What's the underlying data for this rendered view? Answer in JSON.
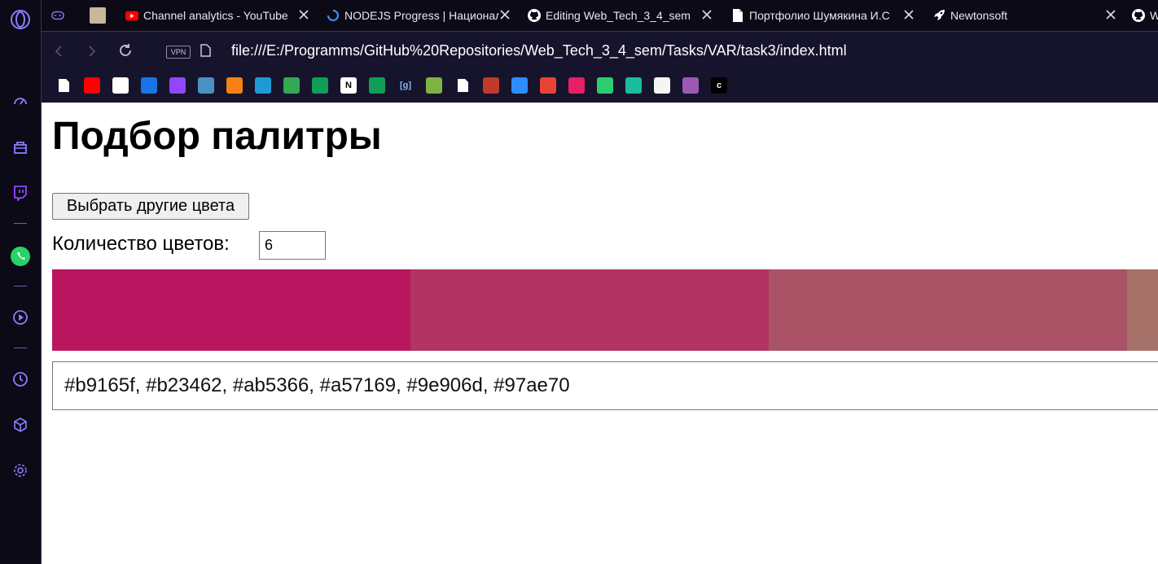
{
  "browser": {
    "tabs": [
      {
        "label": "",
        "icon": "gamepad-icon"
      },
      {
        "label": "",
        "icon": "emblem-icon"
      },
      {
        "label": "Channel analytics - YouTube",
        "icon": "youtube-icon"
      },
      {
        "label": "NODEJS Progress | Национальный",
        "icon": "loading-spinner-icon"
      },
      {
        "label": "Editing Web_Tech_3_4_sem",
        "icon": "github-icon"
      },
      {
        "label": "Портфолио Шумякина И.С",
        "icon": "document-icon"
      },
      {
        "label": "Newtonsoft",
        "icon": "rocket-icon"
      },
      {
        "label": "W",
        "icon": "github-icon"
      }
    ],
    "address": {
      "vpn_label": "VPN",
      "url": "file:///E:/Programms/GitHub%20Repositories/Web_Tech_3_4_sem/Tasks/VAR/task3/index.html"
    },
    "bookmarks": [
      {
        "icon": "page-icon",
        "color": "#ffffff"
      },
      {
        "icon": "youtube-icon",
        "color": "#ff0000"
      },
      {
        "icon": "github-icon",
        "color": "#ffffff"
      },
      {
        "icon": "mail-icon",
        "color": "#1a73e8"
      },
      {
        "icon": "twitch-icon",
        "color": "#9146ff"
      },
      {
        "icon": "m-icon",
        "color": "#4a90c2"
      },
      {
        "icon": "moodle-icon",
        "color": "#f98012"
      },
      {
        "icon": "spinner-icon",
        "color": "#1e9bd7"
      },
      {
        "icon": "google-drive-icon",
        "color": "#34a853"
      },
      {
        "icon": "sheets-plus-icon",
        "color": "#0f9d58"
      },
      {
        "icon": "notion-icon",
        "color": "#ffffff"
      },
      {
        "icon": "sheets-plus-icon",
        "color": "#0f9d58"
      },
      {
        "icon": "bracket-g-icon",
        "color": "#8ab4f8",
        "text": "[g]"
      },
      {
        "icon": "avatar-icon",
        "color": "#7cb342"
      },
      {
        "icon": "page-icon",
        "color": "#ffffff"
      },
      {
        "icon": "bird-icon",
        "color": "#c0392b"
      },
      {
        "icon": "chat-icon",
        "color": "#2d8cff"
      },
      {
        "icon": "gmail-icon",
        "color": "#ea4335"
      },
      {
        "icon": "star-icon",
        "color": "#e91e63"
      },
      {
        "icon": "mountain-icon",
        "color": "#2ecc71"
      },
      {
        "icon": "diamond-icon",
        "color": "#1abc9c"
      },
      {
        "icon": "gear-badge-icon",
        "color": "#f5f5f5"
      },
      {
        "icon": "circle-icon",
        "color": "#9b59b6"
      },
      {
        "icon": "c-icon",
        "color": "#000000"
      }
    ]
  },
  "sidebar": {
    "items": [
      {
        "icon": "opera-logo-icon"
      },
      {
        "icon": "speed-dial-icon"
      },
      {
        "icon": "bag-icon"
      },
      {
        "icon": "twitch-icon"
      },
      {
        "icon": "whatsapp-icon"
      },
      {
        "icon": "player-icon"
      },
      {
        "icon": "history-icon"
      },
      {
        "icon": "box-icon"
      },
      {
        "icon": "settings-icon"
      }
    ]
  },
  "page": {
    "title": "Подбор палитры",
    "pick_button": "Выбрать другие цвета",
    "count_label": "Количество цветов:",
    "count_value": "6",
    "colors": [
      "#b9165f",
      "#b23462",
      "#ab5366",
      "#a57169",
      "#9e906d",
      "#97ae70"
    ],
    "hex_text": "#b9165f, #b23462, #ab5366, #a57169, #9e906d, #97ae70"
  }
}
